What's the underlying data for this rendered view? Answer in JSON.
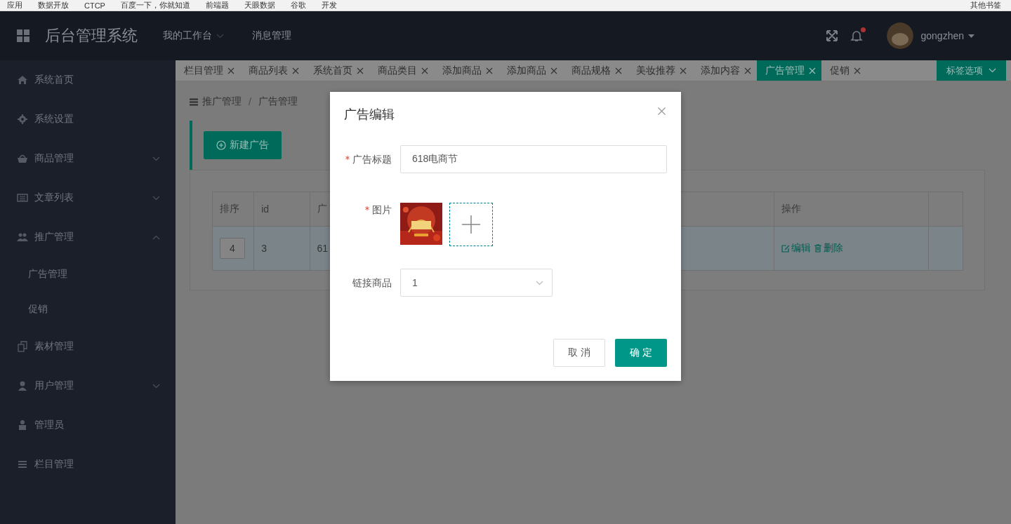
{
  "bookmarks_bar": {
    "items": [
      "应用",
      "数据开放",
      "CTCP",
      "百度一下，你就知道",
      "前端题",
      "天眼数据",
      "谷歌",
      "开发"
    ],
    "other": "其他书签"
  },
  "header": {
    "title": "后台管理系统",
    "menu": [
      {
        "label": "我的工作台",
        "dropdown": true
      },
      {
        "label": "消息管理",
        "dropdown": false
      }
    ],
    "notification_badge": true,
    "user": "gongzhen"
  },
  "sidebar": {
    "items": [
      {
        "kind": "link",
        "label": "系统首页"
      },
      {
        "kind": "link",
        "label": "系统设置"
      },
      {
        "kind": "group",
        "label": "商品管理",
        "expanded": false
      },
      {
        "kind": "group",
        "label": "文章列表",
        "expanded": false
      },
      {
        "kind": "group",
        "label": "推广管理",
        "expanded": true,
        "children": [
          {
            "label": "广告管理"
          },
          {
            "label": "促销"
          }
        ]
      },
      {
        "kind": "link",
        "label": "素材管理"
      },
      {
        "kind": "group",
        "label": "用户管理",
        "expanded": false
      },
      {
        "kind": "link",
        "label": "管理员"
      },
      {
        "kind": "link",
        "label": "栏目管理"
      }
    ]
  },
  "tabs": [
    {
      "label": "栏目管理",
      "selected": false
    },
    {
      "label": "商品列表",
      "selected": false
    },
    {
      "label": "系统首页",
      "selected": false
    },
    {
      "label": "商品类目",
      "selected": false
    },
    {
      "label": "添加商品",
      "selected": false
    },
    {
      "label": "添加商品",
      "selected": false
    },
    {
      "label": "商品规格",
      "selected": false
    },
    {
      "label": "美妆推荐",
      "selected": false
    },
    {
      "label": "添加内容",
      "selected": false
    },
    {
      "label": "广告管理",
      "selected": true
    },
    {
      "label": "促销",
      "selected": false
    }
  ],
  "tab_options": "标签选项",
  "breadcrumb": [
    "推广管理",
    "广告管理"
  ],
  "breadcrumb_separator": "/",
  "new_button": "新建广告",
  "table": {
    "columns": [
      "排序",
      "id",
      "广",
      "操作"
    ],
    "rows": [
      {
        "order": "4",
        "id": "3",
        "column_3": "61",
        "actions": [
          "编辑",
          "删除"
        ]
      }
    ]
  },
  "dialog": {
    "title": "广告编辑",
    "fields": [
      {
        "kind": "text",
        "label": "广告标题",
        "required": true,
        "value": "618电商节"
      },
      {
        "label": "图片",
        "required": true
      },
      {
        "kind": "select",
        "label": "链接商品",
        "required": false,
        "value": "1"
      }
    ],
    "cancel": "取 消",
    "confirm": "确 定"
  }
}
